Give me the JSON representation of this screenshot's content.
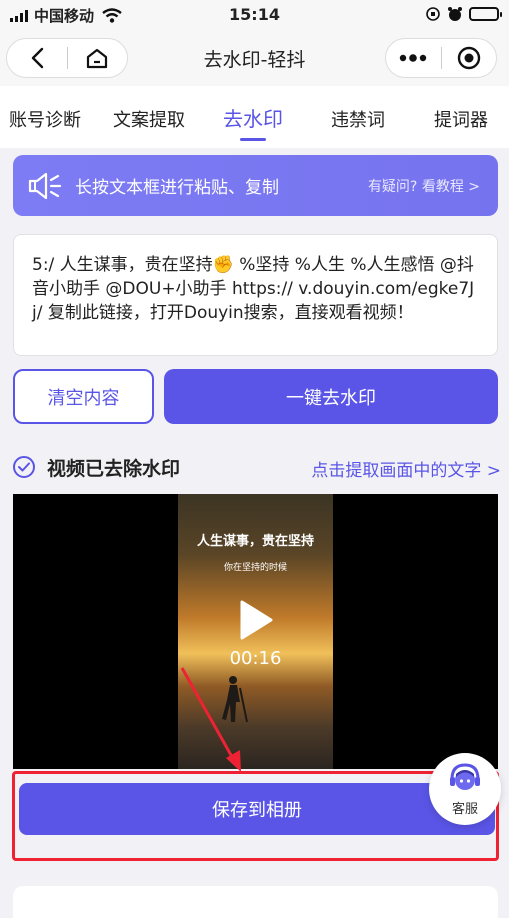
{
  "status_bar": {
    "carrier": "中国移动",
    "time": "15:14"
  },
  "navbar": {
    "title": "去水印-轻抖"
  },
  "tabs": [
    {
      "label": "账号诊断"
    },
    {
      "label": "文案提取"
    },
    {
      "label": "去水印"
    },
    {
      "label": "违禁词"
    },
    {
      "label": "提词器"
    }
  ],
  "active_tab": "去水印",
  "banner": {
    "text": "长按文本框进行粘贴、复制",
    "help": "有疑问? 看教程 >"
  },
  "input": {
    "value": "5:/ 人生谋事，贵在坚持✊ %坚持 %人生 %人生感悟 @抖音小助手 @DOU+小助手  https:// v.douyin.com/egke7Jj/ 复制此链接，打开Douyin搜索，直接观看视频！"
  },
  "actions": {
    "clear": "清空内容",
    "remove": "一键去水印"
  },
  "result": {
    "status": "视频已去除水印",
    "extract_link": "点击提取画面中的文字 >"
  },
  "video": {
    "caption_main": "人生谋事，贵在坚持",
    "caption_sub": "你在坚持的时候",
    "duration": "00:16"
  },
  "save_button": "保存到相册",
  "support": {
    "label": "客服"
  },
  "colors": {
    "accent": "#5a55e6",
    "highlight_box": "#ee2233"
  }
}
